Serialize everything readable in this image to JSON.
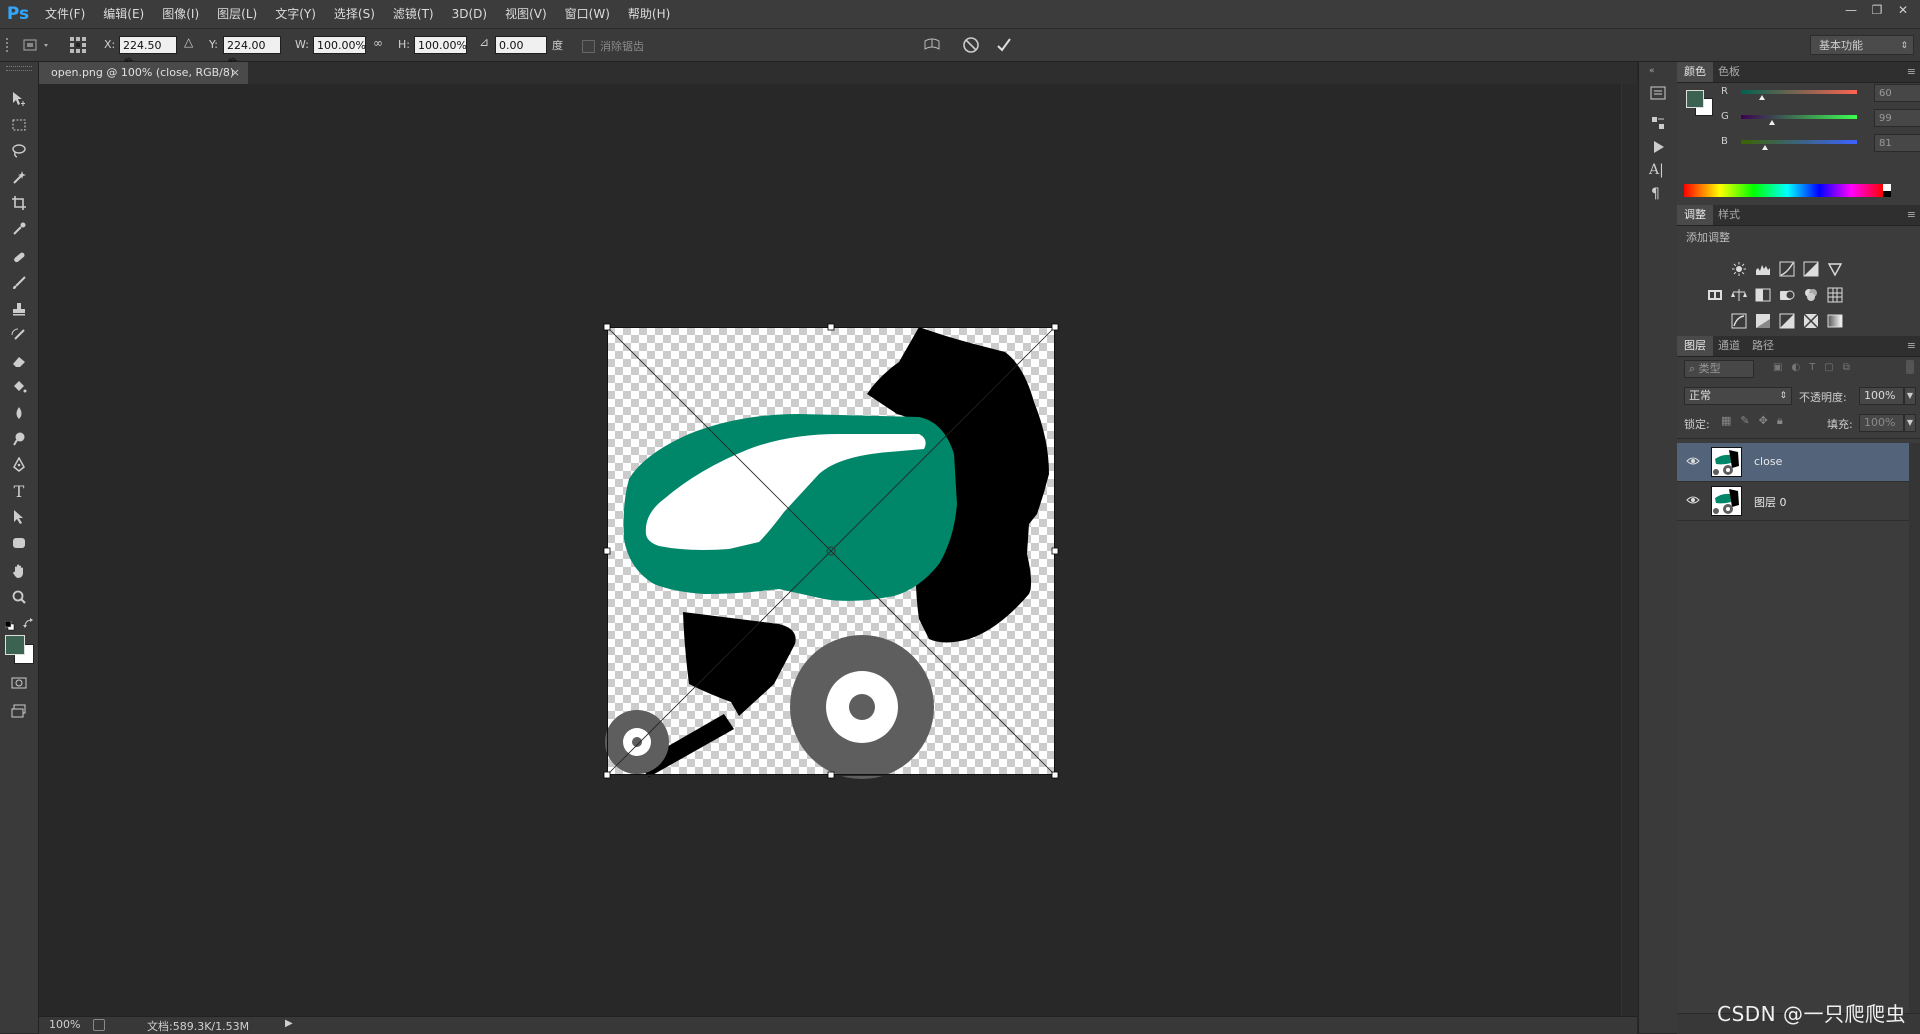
{
  "app": {
    "logo": "Ps",
    "menus": [
      "文件(F)",
      "编辑(E)",
      "图像(I)",
      "图层(L)",
      "文字(Y)",
      "选择(S)",
      "滤镜(T)",
      "3D(D)",
      "视图(V)",
      "窗口(W)",
      "帮助(H)"
    ],
    "window_controls": [
      "—",
      "❐",
      "✕"
    ]
  },
  "options": {
    "x_label": "X:",
    "x_value": "224.50 像",
    "y_label": "Y:",
    "y_value": "224.00 像",
    "w_label": "W:",
    "w_value": "100.00%",
    "h_label": "H:",
    "h_value": "100.00%",
    "angle_value": "0.00",
    "angle_unit": "度",
    "antialias_label": "消除锯齿",
    "workspace": "基本功能"
  },
  "document": {
    "tab_title": "open.png @ 100% (close, RGB/8)",
    "tab_close": "×"
  },
  "status": {
    "zoom": "100%",
    "doc_size": "文档:589.3K/1.53M"
  },
  "color_panel": {
    "tabs": [
      "颜色",
      "色板"
    ],
    "foreground": "#3c6351",
    "r_label": "R",
    "g_label": "G",
    "b_label": "B",
    "r_value": "60",
    "g_value": "99",
    "b_value": "81"
  },
  "adjust_panel": {
    "tabs": [
      "调整",
      "样式"
    ],
    "title": "添加调整",
    "icons": [
      "brightness-icon",
      "levels-icon",
      "curves-icon",
      "exposure-icon",
      "vibrance-icon",
      "hue-sat-icon",
      "color-balance-icon",
      "black-white-icon",
      "photo-filter-icon",
      "channel-mixer-icon",
      "color-lookup-icon",
      "invert-icon",
      "posterize-icon",
      "threshold-icon",
      "selective-color-icon",
      "gradient-map-icon"
    ]
  },
  "layers_panel": {
    "tabs": [
      "图层",
      "通道",
      "路径"
    ],
    "filter_kind": "类型",
    "blend_mode": "正常",
    "opacity_label": "不透明度:",
    "opacity_value": "100%",
    "lock_label": "锁定:",
    "fill_label": "填充:",
    "fill_value": "100%",
    "layers": [
      {
        "name": "close",
        "selected": true
      },
      {
        "name": "图层 0",
        "selected": false
      }
    ]
  },
  "watermark": "CSDN @一只爬爬虫",
  "colors": {
    "green": "#00876a",
    "background": "#282828"
  }
}
